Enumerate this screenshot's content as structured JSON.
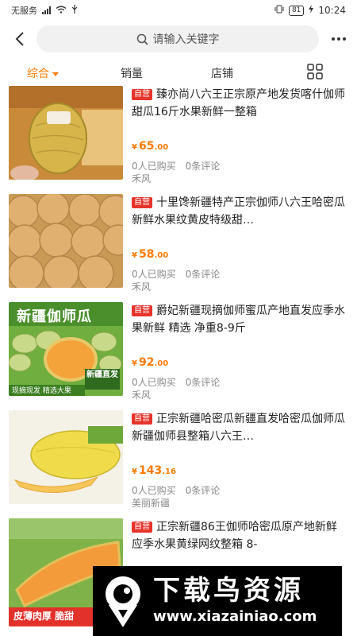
{
  "status_bar": {
    "carrier": "无服务",
    "battery": "81",
    "time": "10:24"
  },
  "header": {
    "search_placeholder": "请输入关键字"
  },
  "sort_tabs": [
    {
      "label": "综合",
      "active": true
    },
    {
      "label": "销量",
      "active": false
    },
    {
      "label": "店铺",
      "active": false
    }
  ],
  "products": [
    {
      "badge": "自营",
      "title": "臻亦尚八六王正宗原产地发货喀什伽师甜瓜16斤水果新鲜一整箱",
      "price_int": "65",
      "price_dec": ".00",
      "currency": "¥",
      "bought": "0人已购买",
      "reviews": "0条评论",
      "shop": "禾风"
    },
    {
      "badge": "自营",
      "title": "十里馋新疆特产正宗伽师八六王哈密瓜新鲜水果纹黄皮特级甜…",
      "price_int": "58",
      "price_dec": ".00",
      "currency": "¥",
      "bought": "0人已购买",
      "reviews": "0条评论",
      "shop": "禾风"
    },
    {
      "badge": "自营",
      "title": "爵妃新疆现摘伽师蜜瓜产地直发应季水果新鲜 精选 净重8-9斤",
      "price_int": "92",
      "price_dec": ".00",
      "currency": "¥",
      "bought": "0人已购买",
      "reviews": "0条评论",
      "shop": "禾风",
      "thumb_text": {
        "top": "新疆伽师瓜",
        "tag": "新疆直发",
        "bottom": "现摘现发 精选大果"
      }
    },
    {
      "badge": "自营",
      "title": "正宗新疆哈密瓜新疆直发哈密瓜伽师瓜新疆伽师县整箱八六王…",
      "price_int": "143",
      "price_dec": ".16",
      "currency": "¥",
      "bought": "0人已购买",
      "reviews": "0条评论",
      "shop": "美丽新疆"
    },
    {
      "badge": "自营",
      "title": "正宗新疆86王伽师哈密瓜原产地新鲜应季水果黄绿网纹整箱 8-",
      "price_int": "",
      "price_dec": "",
      "currency": "",
      "bought": "",
      "reviews": "",
      "shop": "",
      "thumb_text": {
        "bottom": "皮薄肉厚 脆甜"
      }
    }
  ],
  "watermark": {
    "cn": "下载鸟资源",
    "url": "www.xiazainiao.com"
  },
  "colors": {
    "accent": "#ff7a00",
    "badge": "#e6342b"
  }
}
